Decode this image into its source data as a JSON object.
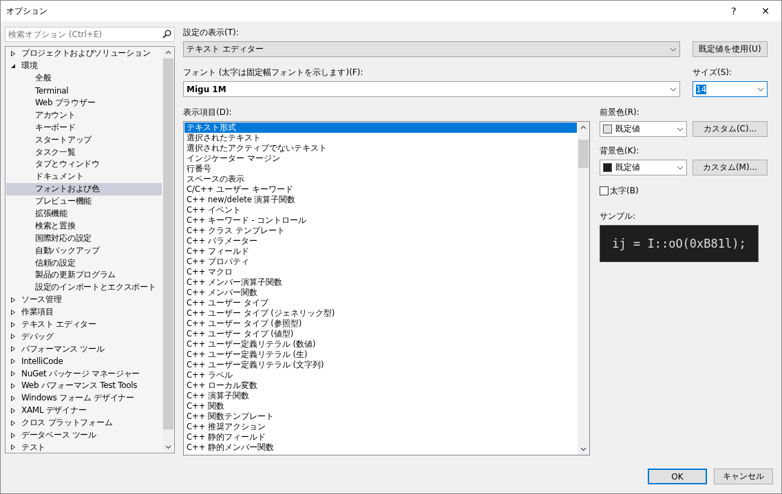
{
  "window": {
    "title": "オプション",
    "help": "?",
    "close": "✕"
  },
  "search": {
    "placeholder": "検索オプション (Ctrl+E)"
  },
  "tree": [
    {
      "label": "プロジェクトおよびソリューション",
      "expanded": false,
      "selected": false
    },
    {
      "label": "環境",
      "expanded": true,
      "selected": false,
      "children": [
        {
          "label": "全般",
          "selected": false
        },
        {
          "label": "Terminal",
          "selected": false
        },
        {
          "label": "Web ブラウザー",
          "selected": false
        },
        {
          "label": "アカウント",
          "selected": false
        },
        {
          "label": "キーボード",
          "selected": false
        },
        {
          "label": "スタートアップ",
          "selected": false
        },
        {
          "label": "タスク一覧",
          "selected": false
        },
        {
          "label": "タブとウィンドウ",
          "selected": false
        },
        {
          "label": "ドキュメント",
          "selected": false
        },
        {
          "label": "フォントおよび色",
          "selected": true
        },
        {
          "label": "プレビュー機能",
          "selected": false
        },
        {
          "label": "拡張機能",
          "selected": false
        },
        {
          "label": "検索と置換",
          "selected": false
        },
        {
          "label": "国際対応の設定",
          "selected": false
        },
        {
          "label": "自動バックアップ",
          "selected": false
        },
        {
          "label": "信頼の設定",
          "selected": false
        },
        {
          "label": "製品の更新プログラム",
          "selected": false
        },
        {
          "label": "設定のインポートとエクスポート",
          "selected": false
        }
      ]
    },
    {
      "label": "ソース管理",
      "expanded": false,
      "selected": false
    },
    {
      "label": "作業項目",
      "expanded": false,
      "selected": false
    },
    {
      "label": "テキスト エディター",
      "expanded": false,
      "selected": false
    },
    {
      "label": "デバッグ",
      "expanded": false,
      "selected": false
    },
    {
      "label": "パフォーマンス ツール",
      "expanded": false,
      "selected": false
    },
    {
      "label": "IntelliCode",
      "expanded": false,
      "selected": false
    },
    {
      "label": "NuGet パッケージ マネージャー",
      "expanded": false,
      "selected": false
    },
    {
      "label": "Web パフォーマンス Test Tools",
      "expanded": false,
      "selected": false
    },
    {
      "label": "Windows フォーム デザイナー",
      "expanded": false,
      "selected": false
    },
    {
      "label": "XAML デザイナー",
      "expanded": false,
      "selected": false
    },
    {
      "label": "クロス プラットフォーム",
      "expanded": false,
      "selected": false
    },
    {
      "label": "データベース ツール",
      "expanded": false,
      "selected": false
    },
    {
      "label": "テスト",
      "expanded": false,
      "selected": false
    }
  ],
  "settings_label": "設定の表示(T):",
  "settings_value": "テキスト エディター",
  "default_button": "既定値を使用(U)",
  "font_label": "フォント (太字は固定幅フォントを示します)(F):",
  "font_value": "Migu 1M",
  "size_label": "サイズ(S):",
  "size_value": "14",
  "items_label": "表示項目(D):",
  "items": [
    {
      "label": "テキスト形式",
      "selected": true
    },
    {
      "label": "選択されたテキスト",
      "selected": false
    },
    {
      "label": "選択されたアクティブでないテキスト",
      "selected": false
    },
    {
      "label": "インジケーター マージン",
      "selected": false
    },
    {
      "label": "行番号",
      "selected": false
    },
    {
      "label": "スペースの表示",
      "selected": false
    },
    {
      "label": "C/C++ ユーザー キーワード",
      "selected": false
    },
    {
      "label": "C++ new/delete 演算子関数",
      "selected": false
    },
    {
      "label": "C++ イベント",
      "selected": false
    },
    {
      "label": "C++ キーワード - コントロール",
      "selected": false
    },
    {
      "label": "C++ クラス テンプレート",
      "selected": false
    },
    {
      "label": "C++ パラメーター",
      "selected": false
    },
    {
      "label": "C++ フィールド",
      "selected": false
    },
    {
      "label": "C++ プロパティ",
      "selected": false
    },
    {
      "label": "C++ マクロ",
      "selected": false
    },
    {
      "label": "C++ メンバー演算子関数",
      "selected": false
    },
    {
      "label": "C++ メンバー関数",
      "selected": false
    },
    {
      "label": "C++ ユーザー タイプ",
      "selected": false
    },
    {
      "label": "C++ ユーザー タイプ (ジェネリック型)",
      "selected": false
    },
    {
      "label": "C++ ユーザー タイプ (参照型)",
      "selected": false
    },
    {
      "label": "C++ ユーザー タイプ (値型)",
      "selected": false
    },
    {
      "label": "C++ ユーザー定義リテラル (数値)",
      "selected": false
    },
    {
      "label": "C++ ユーザー定義リテラル (生)",
      "selected": false
    },
    {
      "label": "C++ ユーザー定義リテラル (文字列)",
      "selected": false
    },
    {
      "label": "C++ ラベル",
      "selected": false
    },
    {
      "label": "C++ ローカル変数",
      "selected": false
    },
    {
      "label": "C++ 演算子関数",
      "selected": false
    },
    {
      "label": "C++ 関数",
      "selected": false
    },
    {
      "label": "C++ 関数テンプレート",
      "selected": false
    },
    {
      "label": "C++ 推奨アクション",
      "selected": false
    },
    {
      "label": "C++ 静的フィールド",
      "selected": false
    },
    {
      "label": "C++ 静的メンバー関数",
      "selected": false
    }
  ],
  "foreground": {
    "label": "前景色(R):",
    "value": "既定値",
    "color": "#e3e3e3",
    "custom_button": "カスタム(C)..."
  },
  "background": {
    "label": "背景色(K):",
    "value": "既定値",
    "color": "#1e1e1e",
    "custom_button": "カスタム(M)..."
  },
  "bold": {
    "label": "太字(B)",
    "checked": false
  },
  "sample": {
    "label": "サンプル:",
    "text": "ij = I::oO(0xB81l);"
  },
  "buttons": [
    "OK",
    "キャンセル"
  ]
}
